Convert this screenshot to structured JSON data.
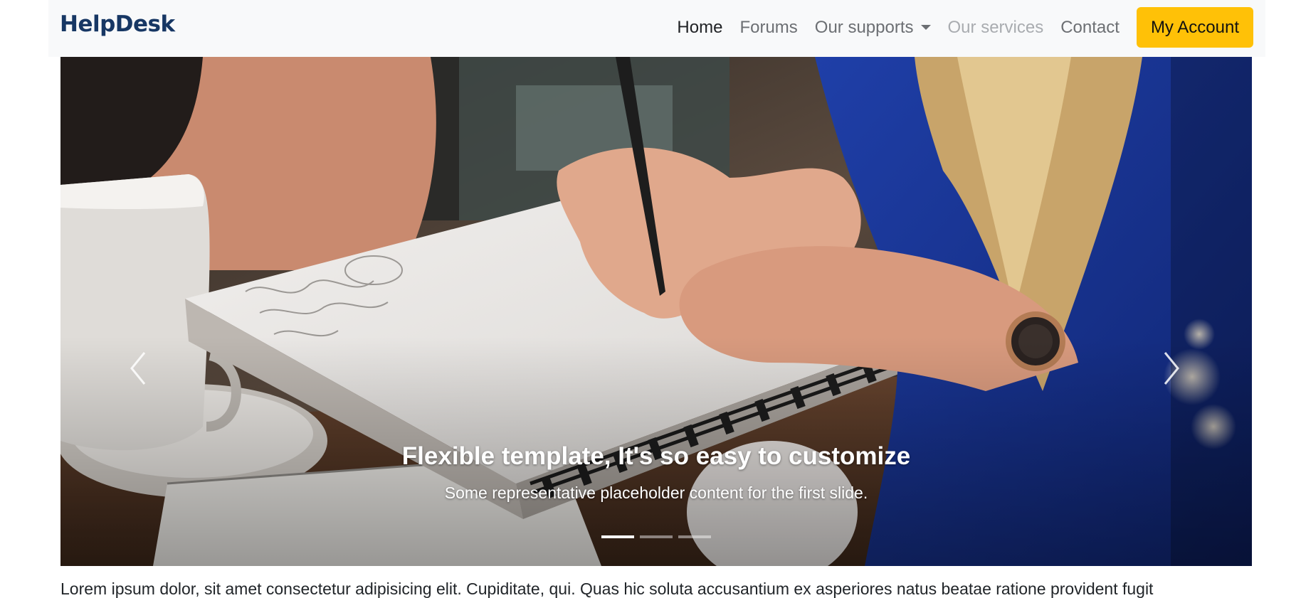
{
  "brand": {
    "name": "HelpDesk",
    "color": "#173764"
  },
  "nav": {
    "items": [
      {
        "label": "Home",
        "state": "active"
      },
      {
        "label": "Forums",
        "state": "normal"
      },
      {
        "label": "Our supports",
        "state": "dropdown"
      },
      {
        "label": "Our services",
        "state": "disabled"
      },
      {
        "label": "Contact",
        "state": "normal"
      }
    ],
    "account_button": "My Account",
    "account_color": "#ffc107"
  },
  "carousel": {
    "slide_title": "Flexible template, It's so easy to customize",
    "slide_text": "Some representative placeholder content for the first slide.",
    "prev_icon": "chevron-left-icon",
    "next_icon": "chevron-right-icon",
    "slide_count": 3,
    "active_slide": 1
  },
  "content": {
    "lead_text": "Lorem ipsum dolor, sit amet consectetur adipisicing elit. Cupiditate, qui. Quas hic soluta accusantium ex asperiores natus beatae ratione provident fugit"
  }
}
